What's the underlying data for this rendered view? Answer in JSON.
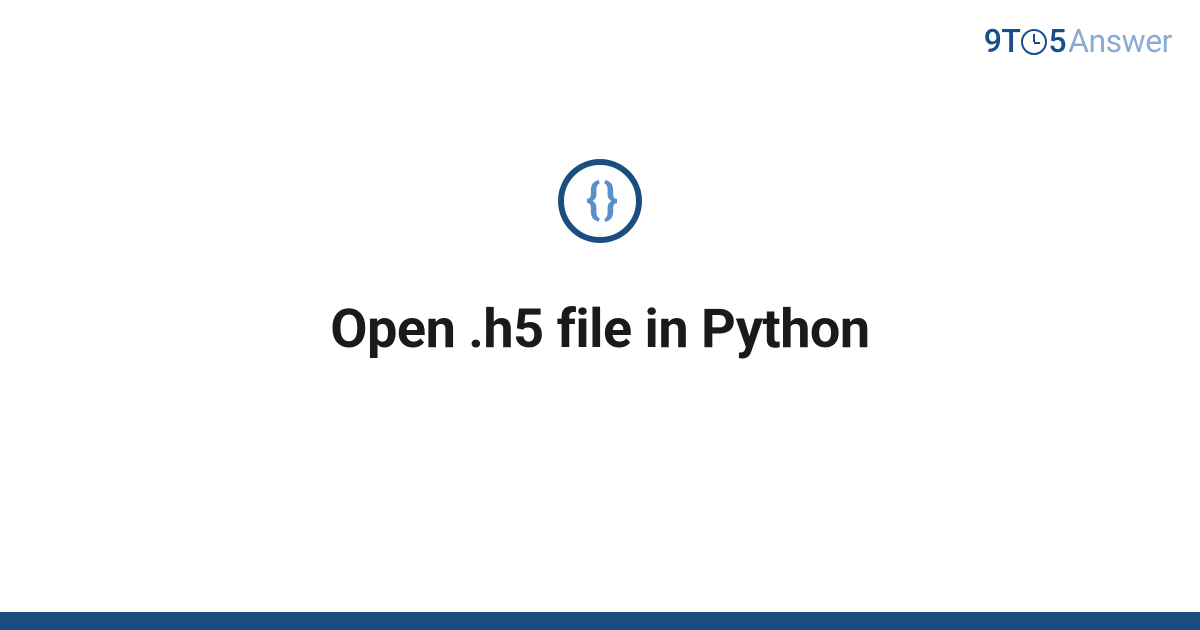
{
  "logo": {
    "nine": "9",
    "t": "T",
    "five": "5",
    "answer": "Answer"
  },
  "badge": {
    "braces": "{ }"
  },
  "title": "Open .h5 file in Python"
}
